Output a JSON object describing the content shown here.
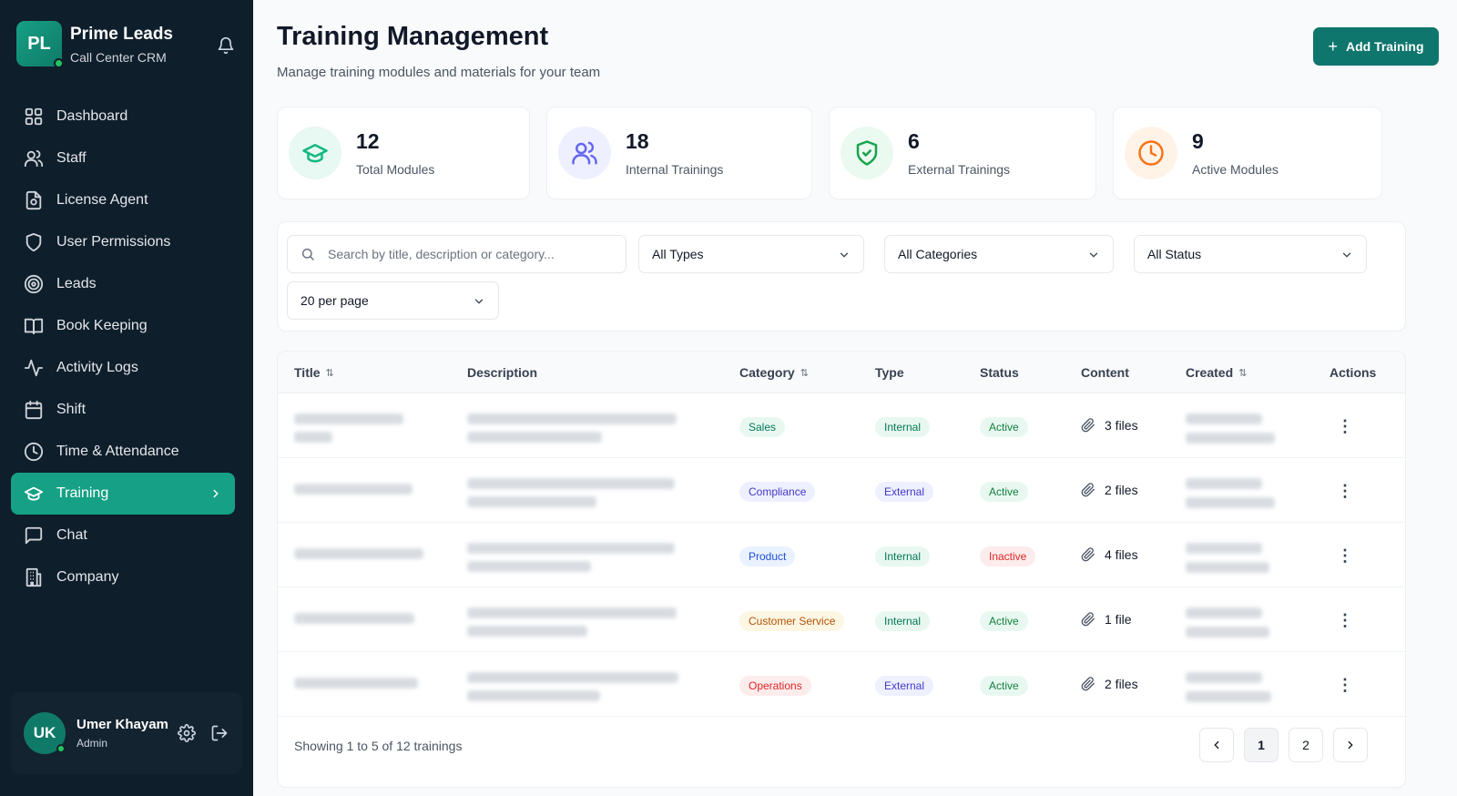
{
  "brand": {
    "logo": "PL",
    "name": "Prime Leads",
    "subtitle": "Call Center CRM"
  },
  "sidebar": {
    "items": [
      {
        "label": "Dashboard",
        "icon": "grid-icon"
      },
      {
        "label": "Staff",
        "icon": "users-icon"
      },
      {
        "label": "License Agent",
        "icon": "file-badge-icon"
      },
      {
        "label": "User Permissions",
        "icon": "shield-icon"
      },
      {
        "label": "Leads",
        "icon": "target-icon"
      },
      {
        "label": "Book Keeping",
        "icon": "book-icon"
      },
      {
        "label": "Activity Logs",
        "icon": "activity-icon"
      },
      {
        "label": "Shift",
        "icon": "calendar-icon"
      },
      {
        "label": "Time & Attendance",
        "icon": "clock-icon"
      },
      {
        "label": "Training",
        "icon": "graduation-cap-icon",
        "active": true
      },
      {
        "label": "Chat",
        "icon": "chat-icon"
      },
      {
        "label": "Company",
        "icon": "building-icon"
      }
    ]
  },
  "user": {
    "initials": "UK",
    "name": "Umer Khayam",
    "role": "Admin"
  },
  "header": {
    "title": "Training Management",
    "subtitle": "Manage training modules and materials for your team",
    "add_label": "Add Training"
  },
  "stats": [
    {
      "value": "12",
      "label": "Total Modules",
      "icon": "graduation-cap-icon",
      "color": "#10b981"
    },
    {
      "value": "18",
      "label": "Internal Trainings",
      "icon": "users-icon",
      "color": "#6366f1"
    },
    {
      "value": "6",
      "label": "External Trainings",
      "icon": "shield-check-icon",
      "color": "#16a34a"
    },
    {
      "value": "9",
      "label": "Active Modules",
      "icon": "clock-icon",
      "color": "#f97316"
    }
  ],
  "filters": {
    "search_placeholder": "Search by title, description or category...",
    "type": "All Types",
    "category": "All Categories",
    "status": "All Status",
    "per_page": "20 per page"
  },
  "table": {
    "columns": {
      "title": "Title",
      "description": "Description",
      "category": "Category",
      "type": "Type",
      "status": "Status",
      "content": "Content",
      "created": "Created",
      "actions": "Actions"
    },
    "rows": [
      {
        "category": "Sales",
        "type": "Internal",
        "status": "Active",
        "content": "3 files"
      },
      {
        "category": "Compliance",
        "type": "External",
        "status": "Active",
        "content": "2 files"
      },
      {
        "category": "Product",
        "type": "Internal",
        "status": "Inactive",
        "content": "4 files"
      },
      {
        "category": "Customer Service",
        "type": "Internal",
        "status": "Active",
        "content": "1 file"
      },
      {
        "category": "Operations",
        "type": "External",
        "status": "Active",
        "content": "2 files"
      }
    ],
    "footer": "Showing 1 to 5 of 12 trainings",
    "pages": [
      "1",
      "2"
    ]
  },
  "colors": {
    "accent": "#16a085",
    "sidebar_bg": "#0e1e2b",
    "active_green": "#16a34a",
    "inactive_red": "#dc2626"
  }
}
